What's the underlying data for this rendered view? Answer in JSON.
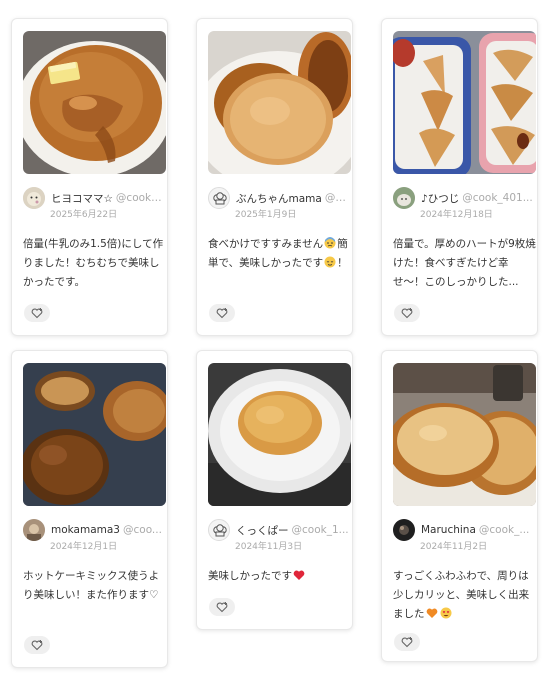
{
  "cards": [
    {
      "author_name": "ヒヨコママ☆",
      "author_handle": "@cook_...",
      "date": "2025年6月22日",
      "comment_text": "倍量(牛乳のみ1.5倍)にして作りました！むちむちで美味しかったです。",
      "avatar_icon": "chick-avatar",
      "photo": "pancake-with-butter-and-syrup"
    },
    {
      "author_name": "ぶんちゃんmama",
      "author_handle": "@c...",
      "date": "2025年1月9日",
      "comment_text": "食べかけですすみません",
      "comment_emoji_1": "anxious-face-emoji",
      "comment_text_2": "簡単で、美味しかったです",
      "comment_emoji_2": "relieved-face-emoji",
      "comment_text_3": "！",
      "avatar_icon": "chef-hat-avatar",
      "photo": "pancakes-on-plate"
    },
    {
      "author_name": "♪ひつじ",
      "author_handle": "@cook_401...",
      "date": "2024年12月18日",
      "comment_text": "倍量で。厚めのハートが9枚焼けた！食べすぎたけど幸せ〜！このしっかりした...",
      "avatar_icon": "sheep-avatar",
      "photo": "heart-pancakes-on-trays"
    },
    {
      "author_name": "mokamama3",
      "author_handle": "@coo...",
      "date": "2024年12月1日",
      "comment_text": "ホットケーキミックス使うより美味しい！また作ります♡",
      "avatar_icon": "photo-avatar",
      "photo": "pancakes-in-frying-pan"
    },
    {
      "author_name": "くっくぱー",
      "author_handle": "@cook_1...",
      "date": "2024年11月3日",
      "comment_text": "美味しかったです",
      "comment_emoji_1": "red-heart-emoji",
      "avatar_icon": "chef-hat-avatar",
      "photo": "pancake-on-white-plate"
    },
    {
      "author_name": "Maruchina",
      "author_handle": "@cook_...",
      "date": "2024年11月2日",
      "comment_text": "すっごくふわふわで、周りは少しカリッと、美味しく出来ました",
      "comment_emoji_1": "orange-heart-emoji",
      "comment_emoji_2": "heart-eyes-emoji",
      "avatar_icon": "dark-photo-avatar",
      "photo": "stacked-fluffy-pancakes"
    }
  ],
  "like_button_icon": "heart-plus-icon",
  "colors": {
    "pancake": "#c98a45",
    "pancake_light": "#e2b06e",
    "border": "#e8e8e8",
    "muted_text": "#aaaaaa",
    "like_bg": "#efefef"
  }
}
